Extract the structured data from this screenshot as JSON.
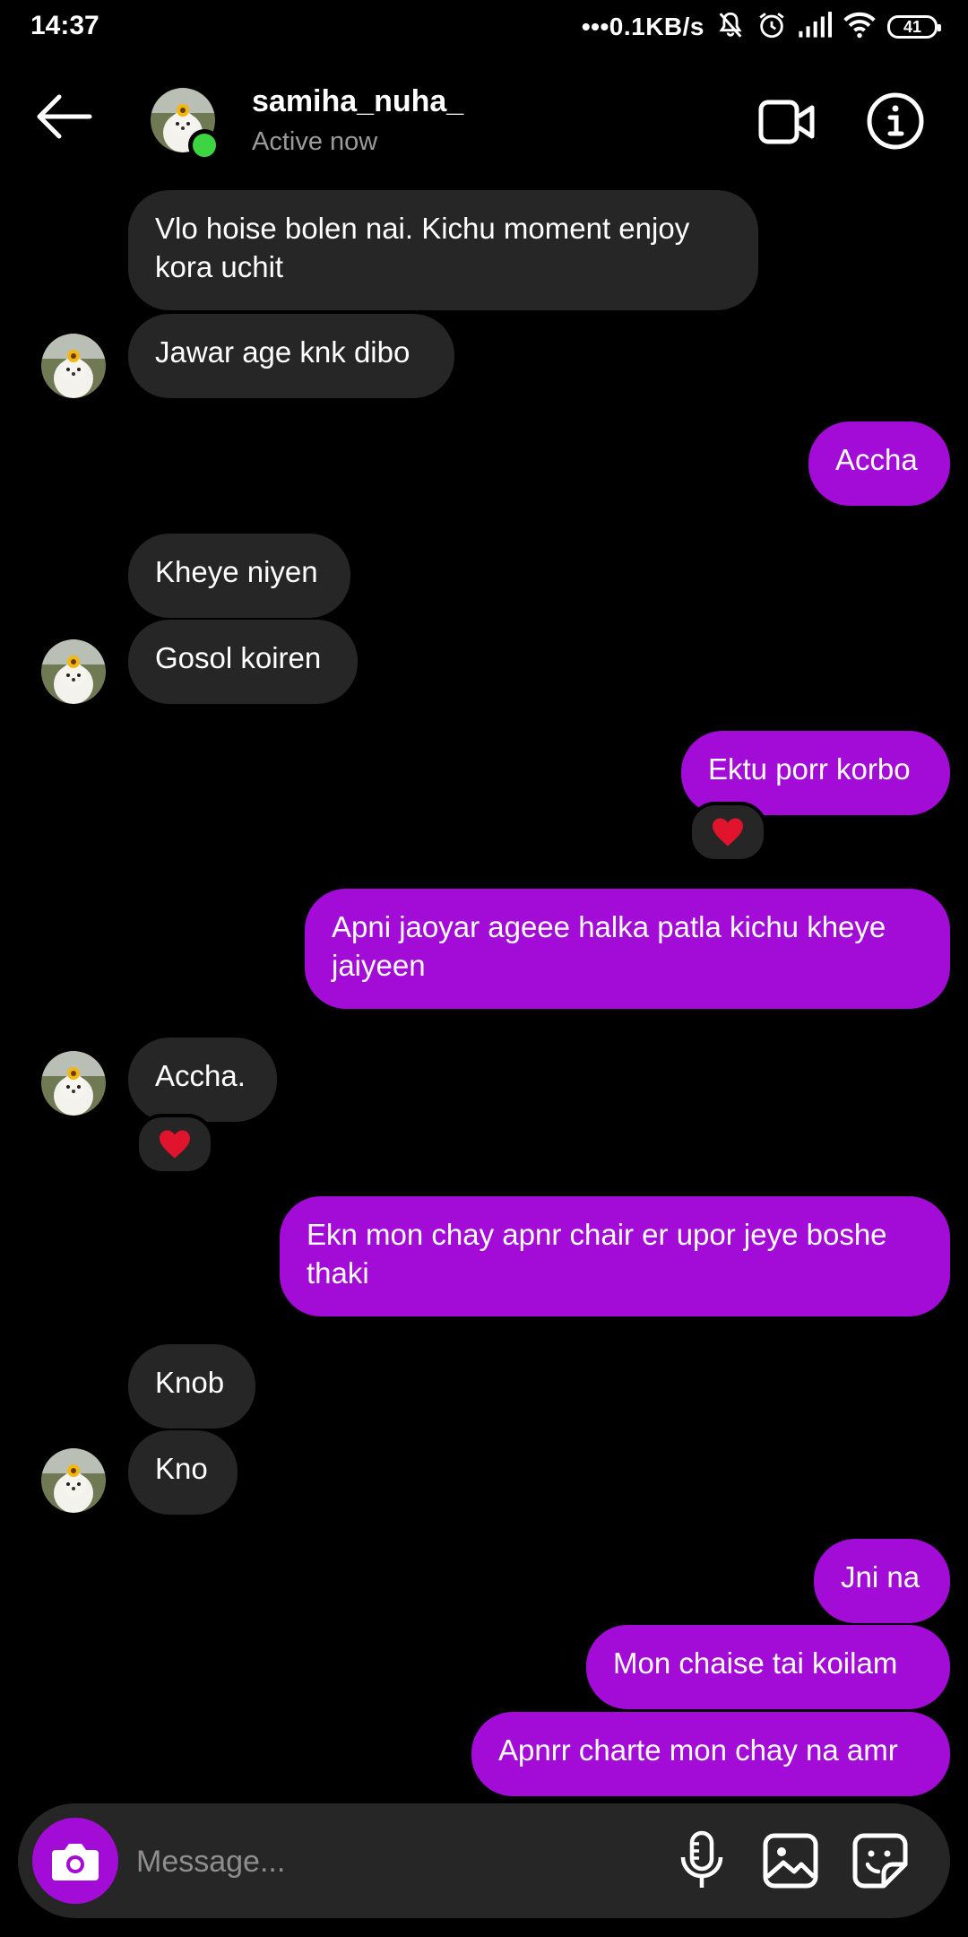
{
  "status_bar": {
    "time": "14:37",
    "network_speed": "•••0.1KB/s",
    "battery": "41"
  },
  "header": {
    "username": "samiha_nuha_",
    "status": "Active now"
  },
  "messages": [
    {
      "dir": "in",
      "text": "Vlo hoise bolen nai. Kichu moment enjoy\nkora uchit"
    },
    {
      "dir": "in",
      "text": "Jawar age knk dibo"
    },
    {
      "dir": "out",
      "text": "Accha"
    },
    {
      "dir": "in",
      "text": "Kheye niyen"
    },
    {
      "dir": "in",
      "text": "Gosol koiren"
    },
    {
      "dir": "out",
      "text": "Ektu porr korbo",
      "reaction": "heart"
    },
    {
      "dir": "out",
      "text": "Apni jaoyar ageee halka patla kichu kheye\njaiyeen"
    },
    {
      "dir": "in",
      "text": "Accha.",
      "reaction": "heart"
    },
    {
      "dir": "out",
      "text": "Ekn mon chay apnr chair er upor jeye boshe\nthaki"
    },
    {
      "dir": "in",
      "text": "Knob"
    },
    {
      "dir": "in",
      "text": "Kno"
    },
    {
      "dir": "out",
      "text": "Jni na"
    },
    {
      "dir": "out",
      "text": "Mon chaise tai koilam"
    },
    {
      "dir": "out",
      "text": "Apnrr charte mon chay na amr"
    }
  ],
  "composer": {
    "placeholder": "Message..."
  },
  "colors": {
    "background": "#000000",
    "incoming_bubble": "#262626",
    "outgoing_bubble": "#a30cd6",
    "online": "#3cd440",
    "reaction_heart": "#e0142c"
  },
  "icons": {
    "back": "arrow-left-icon",
    "video": "video-camera-icon",
    "info": "info-icon",
    "camera": "camera-icon",
    "mic": "microphone-icon",
    "gallery": "image-icon",
    "sticker": "sticker-icon",
    "reaction": "heart-icon"
  }
}
